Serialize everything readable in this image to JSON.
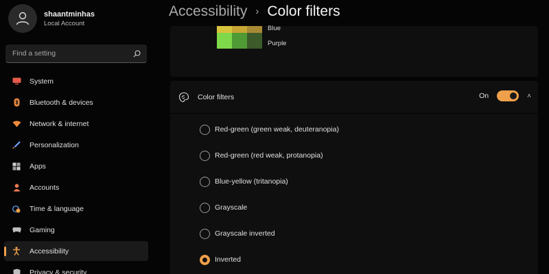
{
  "profile": {
    "name": "shaantminhas",
    "account_type": "Local Account"
  },
  "search": {
    "placeholder": "Find a setting"
  },
  "nav": {
    "items": [
      {
        "label": "System",
        "icon": "monitor-icon",
        "color": "#e55b4a"
      },
      {
        "label": "Bluetooth & devices",
        "icon": "bluetooth-icon",
        "color": "#f08a3c"
      },
      {
        "label": "Network & internet",
        "icon": "wifi-icon",
        "color": "#f08a3c"
      },
      {
        "label": "Personalization",
        "icon": "brush-icon",
        "color": "#6fa8ff"
      },
      {
        "label": "Apps",
        "icon": "apps-icon",
        "color": "#cfcfcf"
      },
      {
        "label": "Accounts",
        "icon": "person-icon",
        "color": "#f07a52"
      },
      {
        "label": "Time & language",
        "icon": "globe-clock-icon",
        "color": "#f0a04b"
      },
      {
        "label": "Gaming",
        "icon": "controller-icon",
        "color": "#bdbdbd"
      },
      {
        "label": "Accessibility",
        "icon": "accessibility-icon",
        "color": "#f0a04b",
        "active": true
      },
      {
        "label": "Privacy & security",
        "icon": "shield-icon",
        "color": "#bdbdbd"
      }
    ]
  },
  "breadcrumb": {
    "parent": "Accessibility",
    "separator": "›",
    "current": "Color filters"
  },
  "preview": {
    "labels": [
      "Blue",
      "Purple"
    ],
    "swatch_colors": {
      "row1": [
        "#d8c33c",
        "#c8a633",
        "#a88a35"
      ],
      "row2": [
        "#7fd84a",
        "#4f9a35",
        "#3c5a2a"
      ]
    }
  },
  "color_filters": {
    "title": "Color filters",
    "toggle_state": "On",
    "toggle_on": true,
    "options": [
      {
        "label": "Red-green (green weak, deuteranopia)",
        "checked": false
      },
      {
        "label": "Red-green (red weak, protanopia)",
        "checked": false
      },
      {
        "label": "Blue-yellow (tritanopia)",
        "checked": false
      },
      {
        "label": "Grayscale",
        "checked": false
      },
      {
        "label": "Grayscale inverted",
        "checked": false
      },
      {
        "label": "Inverted",
        "checked": true
      }
    ]
  },
  "colors": {
    "accent": "#f0a04b",
    "background": "#050505",
    "card": "#0f0f0f"
  }
}
